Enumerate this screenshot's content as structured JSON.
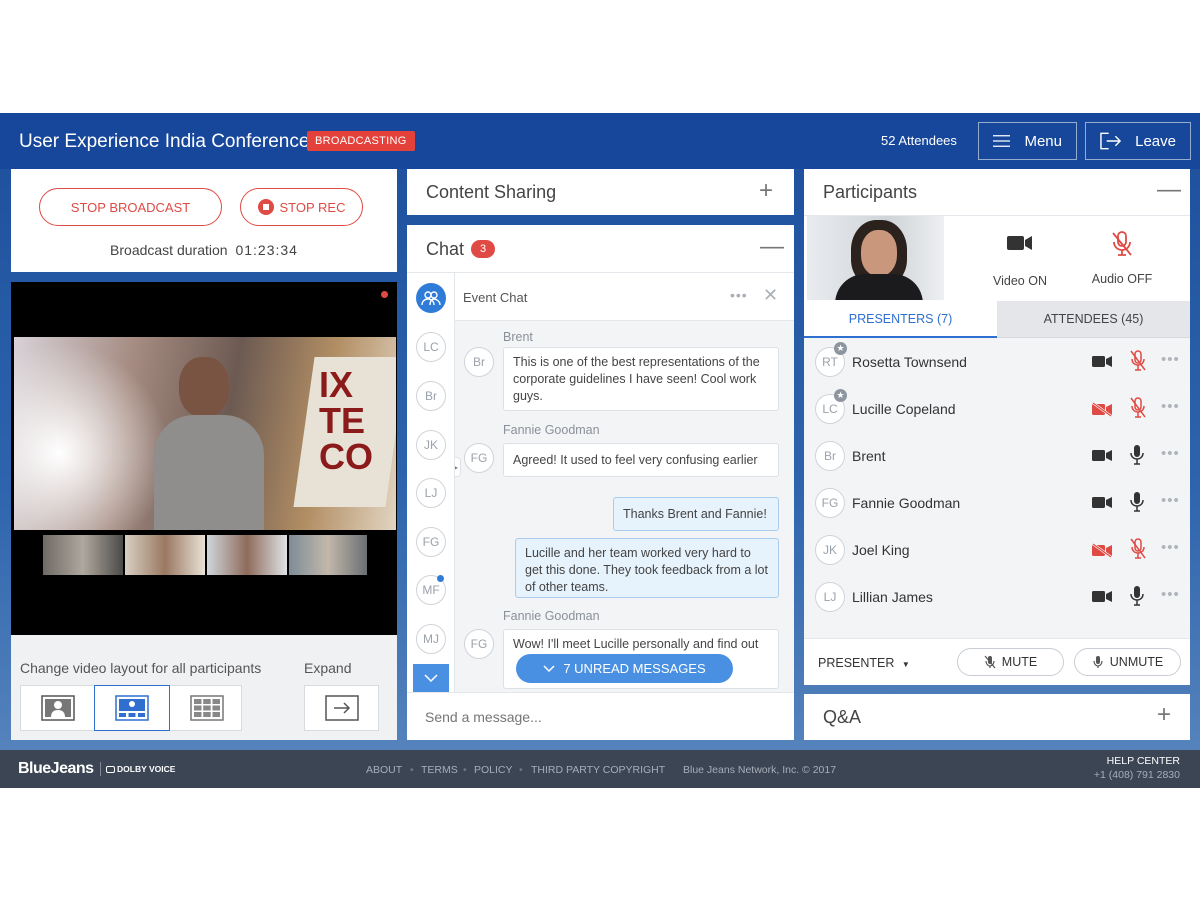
{
  "header": {
    "title": "User Experience India Conference",
    "badge": "BROADCASTING",
    "attendees": "52 Attendees",
    "menu_label": "Menu",
    "leave_label": "Leave"
  },
  "broadcast": {
    "stop_broadcast": "STOP BROADCAST",
    "stop_rec": "STOP REC",
    "duration_label": "Broadcast duration",
    "duration": "01:23:34"
  },
  "layout_controls": {
    "label": "Change video layout for all participants",
    "expand_label": "Expand"
  },
  "content_sharing": {
    "title": "Content Sharing"
  },
  "chat": {
    "title": "Chat",
    "count": "3",
    "channel": "Event Chat",
    "rail": [
      "LC",
      "Br",
      "JK",
      "LJ",
      "FG",
      "MF",
      "MJ"
    ],
    "messages": [
      {
        "sender": "Brent",
        "initials": "Br",
        "text": "This is one of the best representations of the corporate guidelines I have seen! Cool work guys."
      },
      {
        "sender": "Fannie Goodman",
        "initials": "FG",
        "text": "Agreed! It used to feel very confusing earlier"
      },
      {
        "sender": "",
        "initials": "",
        "text": "Thanks Brent and Fannie!"
      },
      {
        "sender": "",
        "initials": "",
        "text": "Lucille and her team worked very hard to get this done. They took feedback from a lot of other teams."
      },
      {
        "sender": "Fannie Goodman",
        "initials": "FG",
        "text": "Wow! I'll meet Lucille personally and find out"
      }
    ],
    "unread": "7 UNREAD MESSAGES",
    "placeholder": "Send a message..."
  },
  "participants": {
    "title": "Participants",
    "video_label": "Video ON",
    "audio_label": "Audio OFF",
    "tab_presenters": "PRESENTERS (7)",
    "tab_attendees": "ATTENDEES (45)",
    "list": [
      {
        "initials": "RT",
        "name": "Rosetta Townsend",
        "video": "on",
        "mic": "off",
        "star": true
      },
      {
        "initials": "LC",
        "name": "Lucille Copeland",
        "video": "off",
        "mic": "off",
        "star": true
      },
      {
        "initials": "Br",
        "name": "Brent",
        "video": "on",
        "mic": "on",
        "star": false
      },
      {
        "initials": "FG",
        "name": "Fannie Goodman",
        "video": "on",
        "mic": "on",
        "star": false
      },
      {
        "initials": "JK",
        "name": "Joel King",
        "video": "off",
        "mic": "off",
        "star": false
      },
      {
        "initials": "LJ",
        "name": "Lillian James",
        "video": "on",
        "mic": "on",
        "star": false
      }
    ],
    "role_select": "PRESENTER",
    "mute": "MUTE",
    "unmute": "UNMUTE"
  },
  "qa": {
    "title": "Q&A"
  },
  "footer": {
    "brand": "BlueJeans",
    "dolby": "DOLBY VOICE",
    "links": [
      "ABOUT",
      "TERMS",
      "POLICY",
      "THIRD PARTY COPYRIGHT"
    ],
    "copyright": "Blue Jeans Network, Inc. © 2017",
    "help": "HELP CENTER",
    "phone": "+1 (408) 791 2830"
  },
  "colors": {
    "brand_blue": "#16479a",
    "accent_red": "#e04a44",
    "link_blue": "#2f6fd0",
    "chat_blue": "#4a90e2"
  }
}
